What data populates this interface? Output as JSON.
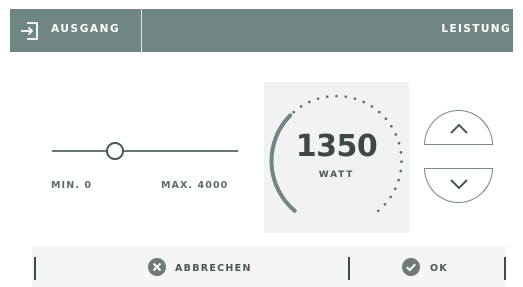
{
  "header": {
    "exit_label": "AUSGANG",
    "title": "LEISTUNG",
    "background": "#6f8684"
  },
  "slider": {
    "min_label": "MIN. 0",
    "max_label": "MAX. 4000",
    "min": 0,
    "max": 4000,
    "value": 1350
  },
  "dial": {
    "value": "1350",
    "unit": "WATT",
    "fraction": 0.3375,
    "accent": "#6f8684"
  },
  "stepper": {
    "up_icon": "chevron-up-icon",
    "down_icon": "chevron-down-icon"
  },
  "footer": {
    "cancel_label": "ABBRECHEN",
    "cancel_icon": "close-circle-icon",
    "ok_label": "OK",
    "ok_icon": "check-circle-icon"
  }
}
